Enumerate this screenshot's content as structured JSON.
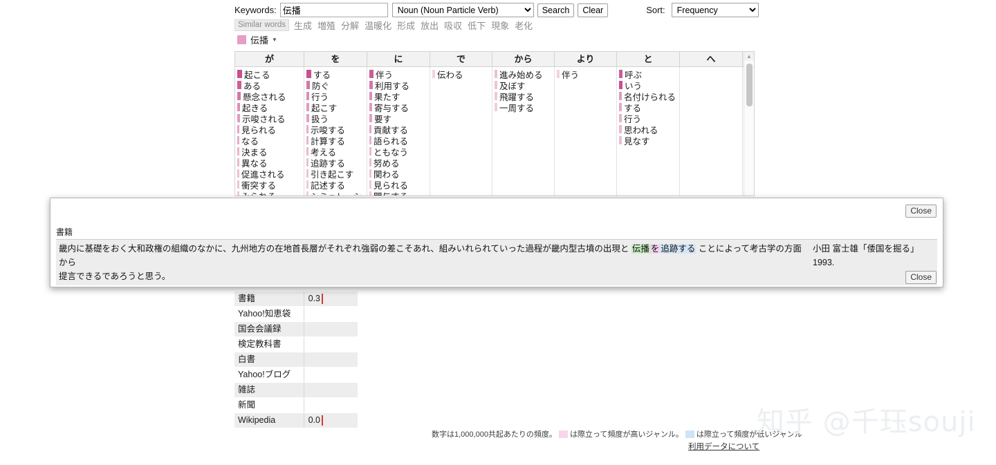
{
  "search": {
    "keywords_label": "Keywords:",
    "keyword_value": "伝播",
    "pos_selected": "Noun (Noun Particle Verb)",
    "search_label": "Search",
    "clear_label": "Clear",
    "sort_label": "Sort:",
    "sort_selected": "Frequency"
  },
  "similar": {
    "tag": "Similar words",
    "words": [
      "生成",
      "増殖",
      "分解",
      "温暖化",
      "形成",
      "放出",
      "吸収",
      "低下",
      "現象",
      "老化"
    ]
  },
  "keyword_chip": {
    "label": "伝播",
    "caret": "▼",
    "swatch_color": "#e59ec4"
  },
  "collocation": {
    "columns": [
      {
        "header": "が",
        "items": [
          {
            "word": "起こる",
            "bar": 7,
            "color": "#c94f8e"
          },
          {
            "word": "ある",
            "bar": 6,
            "color": "#cb5f96"
          },
          {
            "word": "懸念される",
            "bar": 5,
            "color": "#d178a8"
          },
          {
            "word": "起きる",
            "bar": 4,
            "color": "#d98fb6"
          },
          {
            "word": "示唆される",
            "bar": 4,
            "color": "#dd9cbe"
          },
          {
            "word": "見られる",
            "bar": 3,
            "color": "#e2a9c6"
          },
          {
            "word": "なる",
            "bar": 3,
            "color": "#e4aec9"
          },
          {
            "word": "決まる",
            "bar": 3,
            "color": "#e6b5cd"
          },
          {
            "word": "異なる",
            "bar": 3,
            "color": "#e8bad0"
          },
          {
            "word": "促進される",
            "bar": 3,
            "color": "#eac0d4"
          },
          {
            "word": "衝突する",
            "bar": 3,
            "color": "#ecc5d7"
          },
          {
            "word": "みられる",
            "bar": 3,
            "color": "#eecada"
          }
        ]
      },
      {
        "header": "を",
        "items": [
          {
            "word": "する",
            "bar": 7,
            "color": "#c94f8e"
          },
          {
            "word": "防ぐ",
            "bar": 5,
            "color": "#d178a8"
          },
          {
            "word": "行う",
            "bar": 4,
            "color": "#d98fb6"
          },
          {
            "word": "起こす",
            "bar": 4,
            "color": "#dd9cbe"
          },
          {
            "word": "扱う",
            "bar": 4,
            "color": "#dfa2c2"
          },
          {
            "word": "示唆する",
            "bar": 3,
            "color": "#e4aec9"
          },
          {
            "word": "計算する",
            "bar": 3,
            "color": "#e6b5cd"
          },
          {
            "word": "考える",
            "bar": 3,
            "color": "#e8bad0"
          },
          {
            "word": "追跡する",
            "bar": 3,
            "color": "#eac0d4"
          },
          {
            "word": "引き起こす",
            "bar": 3,
            "color": "#ecc5d7"
          },
          {
            "word": "記述する",
            "bar": 3,
            "color": "#eecada"
          },
          {
            "word": "シミュレーシ",
            "bar": 3,
            "color": "#efcedc"
          }
        ]
      },
      {
        "header": "に",
        "items": [
          {
            "word": "伴う",
            "bar": 6,
            "color": "#cb5f96"
          },
          {
            "word": "利用する",
            "bar": 5,
            "color": "#d178a8"
          },
          {
            "word": "果たす",
            "bar": 4,
            "color": "#d98fb6"
          },
          {
            "word": "寄与する",
            "bar": 4,
            "color": "#dd9cbe"
          },
          {
            "word": "要す",
            "bar": 4,
            "color": "#dfa2c2"
          },
          {
            "word": "貢献する",
            "bar": 3,
            "color": "#e2a9c6"
          },
          {
            "word": "語られる",
            "bar": 3,
            "color": "#e6b5cd"
          },
          {
            "word": "ともなう",
            "bar": 3,
            "color": "#e8bad0"
          },
          {
            "word": "努める",
            "bar": 3,
            "color": "#eac0d4"
          },
          {
            "word": "関わる",
            "bar": 3,
            "color": "#ecc5d7"
          },
          {
            "word": "見られる",
            "bar": 3,
            "color": "#eecada"
          },
          {
            "word": "関与する",
            "bar": 3,
            "color": "#efcedc"
          }
        ]
      },
      {
        "header": "で",
        "items": [
          {
            "word": "伝わる",
            "bar": 4,
            "color": "#f0d4e0"
          }
        ]
      },
      {
        "header": "から",
        "items": [
          {
            "word": "進み始める",
            "bar": 4,
            "color": "#eac0d4"
          },
          {
            "word": "及ぼす",
            "bar": 4,
            "color": "#ecc5d7"
          },
          {
            "word": "飛躍する",
            "bar": 4,
            "color": "#eecada"
          },
          {
            "word": "一周する",
            "bar": 4,
            "color": "#efcedc"
          }
        ]
      },
      {
        "header": "より",
        "items": [
          {
            "word": "伴う",
            "bar": 4,
            "color": "#f0d4e0"
          }
        ]
      },
      {
        "header": "と",
        "items": [
          {
            "word": "呼ぶ",
            "bar": 5,
            "color": "#cb5f96"
          },
          {
            "word": "いう",
            "bar": 5,
            "color": "#c94f8e"
          },
          {
            "word": "名付けられる",
            "bar": 4,
            "color": "#dd9cbe"
          },
          {
            "word": "する",
            "bar": 4,
            "color": "#e2a9c6"
          },
          {
            "word": "行う",
            "bar": 4,
            "color": "#e6b5cd"
          },
          {
            "word": "思われる",
            "bar": 4,
            "color": "#e8bad0"
          },
          {
            "word": "見なす",
            "bar": 4,
            "color": "#eac0d4"
          }
        ]
      },
      {
        "header": "へ",
        "items": []
      }
    ]
  },
  "genre_table": {
    "rows": [
      {
        "name": "書籍",
        "value": "0.3",
        "tick": 21
      },
      {
        "name": "Yahoo!知恵袋",
        "value": "",
        "tick": null
      },
      {
        "name": "国会会議録",
        "value": "",
        "tick": null
      },
      {
        "name": "検定教科書",
        "value": "",
        "tick": null
      },
      {
        "name": "白書",
        "value": "",
        "tick": null
      },
      {
        "name": "Yahoo!ブログ",
        "value": "",
        "tick": null
      },
      {
        "name": "雑誌",
        "value": "",
        "tick": null
      },
      {
        "name": "新聞",
        "value": "",
        "tick": null
      },
      {
        "name": "Wikipedia",
        "value": "0.0",
        "tick": 1
      }
    ]
  },
  "footer": {
    "note_part1": "数字は1,000,000共起あたりの頻度。",
    "note_part2": "は際立って頻度が高いジャンル。",
    "note_part3": "は際立って頻度が低いジャンル",
    "link": "利用データについて",
    "high_color": "#f8d6ea",
    "low_color": "#cfe4f7"
  },
  "modal": {
    "close_label": "Close",
    "genre_title": "書籍",
    "sentence": {
      "before": "畿内に基礎をおく大和政権の組織のなかに、九州地方の在地首長層がそれぞれ強弱の差こそあれ、組みいれられていった過程が畿内型古墳の出現と ",
      "keyword": "伝播",
      "particle": "を",
      "verb": "追跡する",
      "after": " ことによって考古学の方面から",
      "line2": "提言できるであろうと思う。"
    },
    "source_line1": "小田 富士雄「倭国を掘る」",
    "source_line2": "1993."
  },
  "watermark": "知乎 @千珏souji"
}
